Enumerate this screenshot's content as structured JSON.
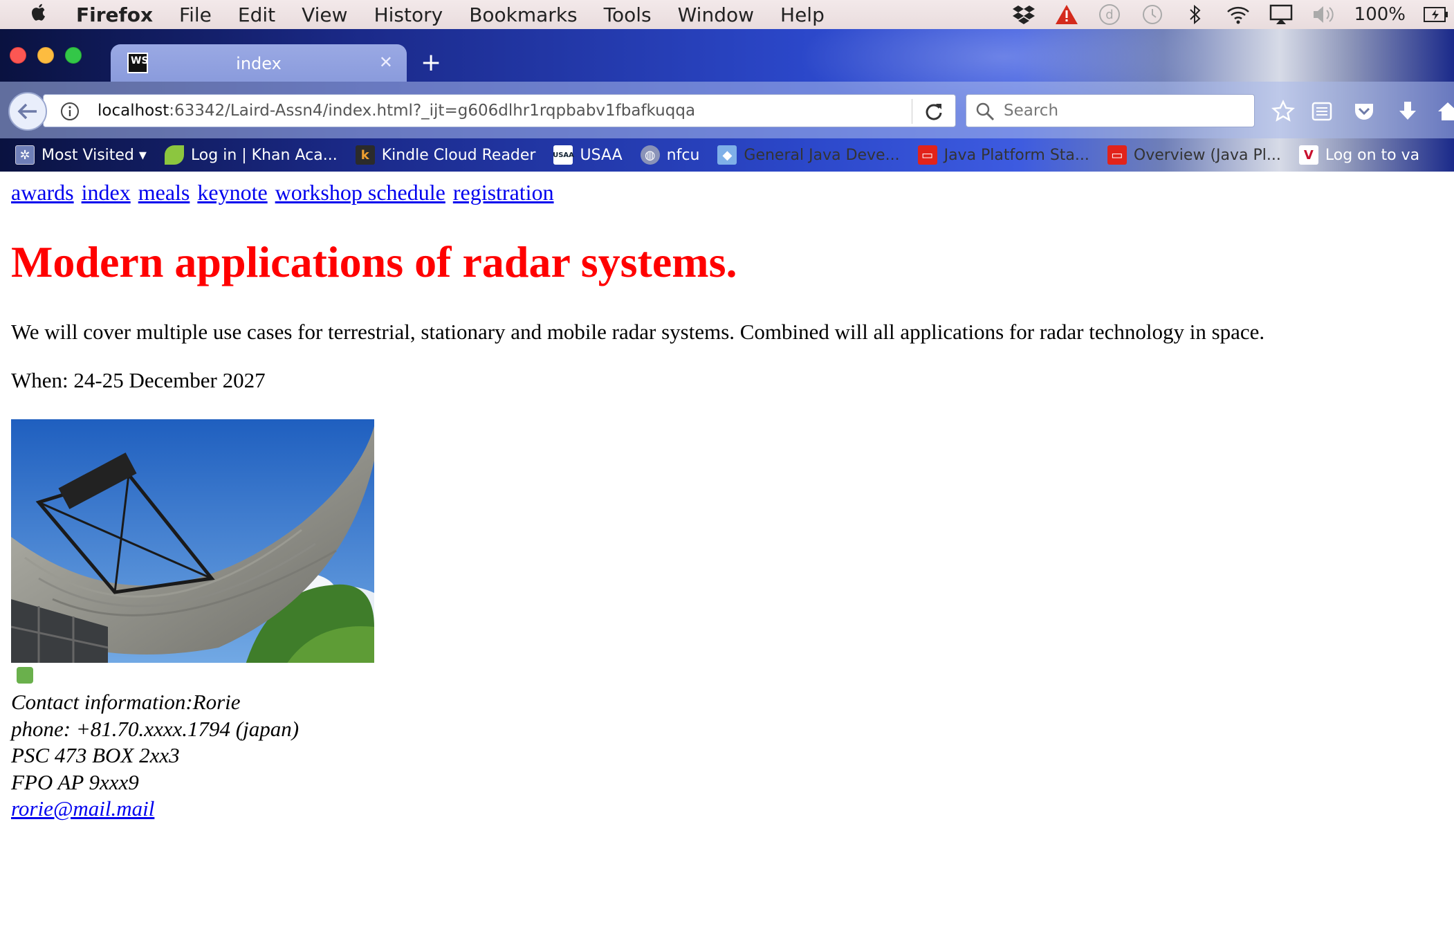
{
  "menubar": {
    "app_name": "Firefox",
    "items": [
      "File",
      "Edit",
      "View",
      "History",
      "Bookmarks",
      "Tools",
      "Window",
      "Help"
    ],
    "battery_percent": "100%"
  },
  "browser": {
    "tab_title": "index",
    "tab_icon_text": "WS",
    "url_host": "localhost",
    "url_rest": ":63342/Laird-Assn4/index.html?_ijt=g606dlhr1rqpbabv1fbafkuqqa",
    "search_placeholder": "Search",
    "bookmarks": [
      {
        "label": "Most Visited ▾",
        "icon": "gear-icon"
      },
      {
        "label": "Log in | Khan Aca...",
        "icon": "leaf-icon"
      },
      {
        "label": "Kindle Cloud Reader",
        "icon": "kindle-icon"
      },
      {
        "label": "USAA",
        "icon": "usaa-icon"
      },
      {
        "label": "nfcu",
        "icon": "globe-icon"
      },
      {
        "label": "General Java Deve...",
        "icon": "cube-icon"
      },
      {
        "label": "Java Platform Sta...",
        "icon": "oracle-icon"
      },
      {
        "label": "Overview (Java Pl...",
        "icon": "oracle-icon"
      },
      {
        "label": "Log on to va",
        "icon": "v-icon"
      }
    ]
  },
  "page": {
    "nav_links": [
      "awards",
      "index",
      "meals",
      "keynote",
      "workshop schedule",
      "registration"
    ],
    "heading": "Modern applications of radar systems.",
    "description": "We will cover multiple use cases for terrestrial, stationary and mobile radar systems. Combined will all applications for radar technology in space.",
    "when": "When: 24-25 December 2027",
    "contact_lines": [
      "Contact information:Rorie",
      "phone: +81.70.xxxx.1794 (japan)",
      "PSC 473 BOX 2xx3",
      "FPO AP 9xxx9"
    ],
    "email": "rorie@mail.mail"
  }
}
